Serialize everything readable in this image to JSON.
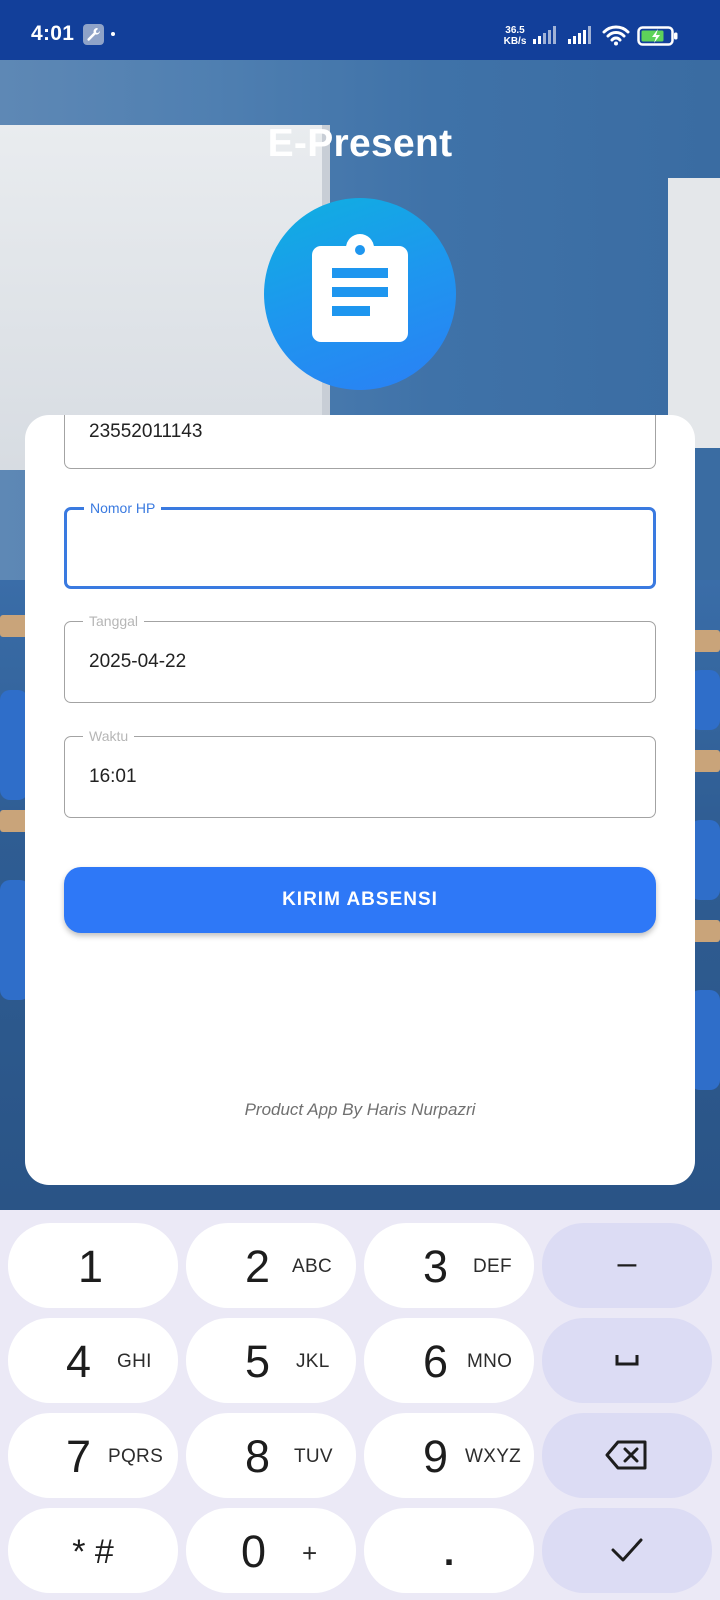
{
  "status_bar": {
    "time": "4:01",
    "net_speed_value": "36.5",
    "net_speed_unit": "KB/s",
    "icons": [
      "wrench-icon",
      "signal-icon",
      "signal-icon",
      "wifi-icon",
      "battery-charging-icon"
    ]
  },
  "header": {
    "title": "E-Present",
    "logo_icon": "clipboard-icon"
  },
  "form": {
    "nim_value": "23552011143",
    "phone": {
      "label": "Nomor HP",
      "value": ""
    },
    "date": {
      "label": "Tanggal",
      "value": "2025-04-22"
    },
    "time": {
      "label": "Waktu",
      "value": "16:01"
    },
    "submit_label": "KIRIM ABSENSI"
  },
  "footer": {
    "credit": "Product App By Haris Nurpazri"
  },
  "keyboard": {
    "keys": [
      {
        "digit": "1",
        "letters": ""
      },
      {
        "digit": "2",
        "letters": "ABC"
      },
      {
        "digit": "3",
        "letters": "DEF"
      },
      {
        "digit": "4",
        "letters": "GHI"
      },
      {
        "digit": "5",
        "letters": "JKL"
      },
      {
        "digit": "6",
        "letters": "MNO"
      },
      {
        "digit": "7",
        "letters": "PQRS"
      },
      {
        "digit": "8",
        "letters": "TUV"
      },
      {
        "digit": "9",
        "letters": "WXYZ"
      },
      {
        "digit": "0",
        "letters": "+"
      }
    ],
    "symbols_key": "* #",
    "dot_key": ".",
    "minus_key": "–",
    "action_icons": [
      "minus-icon",
      "space-icon",
      "backspace-icon",
      "checkmark-icon"
    ]
  },
  "colors": {
    "status_bar": "#123f9a",
    "accent": "#2e78f7",
    "focus": "#3a7ae0",
    "keyboard_bg": "#ebe9f6",
    "action_key": "#dcdcf4"
  }
}
